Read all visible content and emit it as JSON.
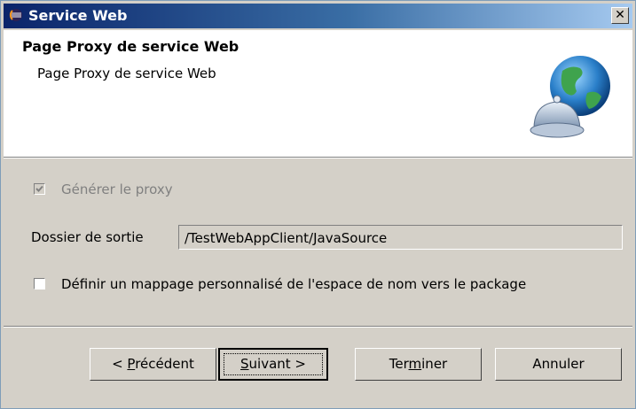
{
  "window": {
    "title": "Service Web",
    "close_glyph": "✕",
    "icon": "eclipse-icon"
  },
  "header": {
    "title": "Page Proxy de service Web",
    "description": "Page Proxy de service Web",
    "icon": "web-service-globe-icon"
  },
  "options": {
    "generate_proxy": {
      "label": "Générer le proxy",
      "checked": true,
      "enabled": false
    },
    "output_folder": {
      "label": "Dossier de sortie",
      "value": "/TestWebAppClient/JavaSource"
    },
    "custom_mapping": {
      "label": "Définir un mappage personnalisé de l'espace de nom vers le package",
      "checked": false
    }
  },
  "buttons": {
    "back": {
      "prefix": "< ",
      "mnemonic": "P",
      "rest": "récédent"
    },
    "next": {
      "prefix": "",
      "mnemonic": "S",
      "rest": "uivant >"
    },
    "finish": {
      "prefix": "Ter",
      "mnemonic": "m",
      "rest": "iner"
    },
    "cancel": {
      "label": "Annuler"
    }
  },
  "colors": {
    "dialog_bg": "#d4d0c8",
    "titlebar_start": "#0a246a",
    "titlebar_end": "#a6caf0"
  }
}
